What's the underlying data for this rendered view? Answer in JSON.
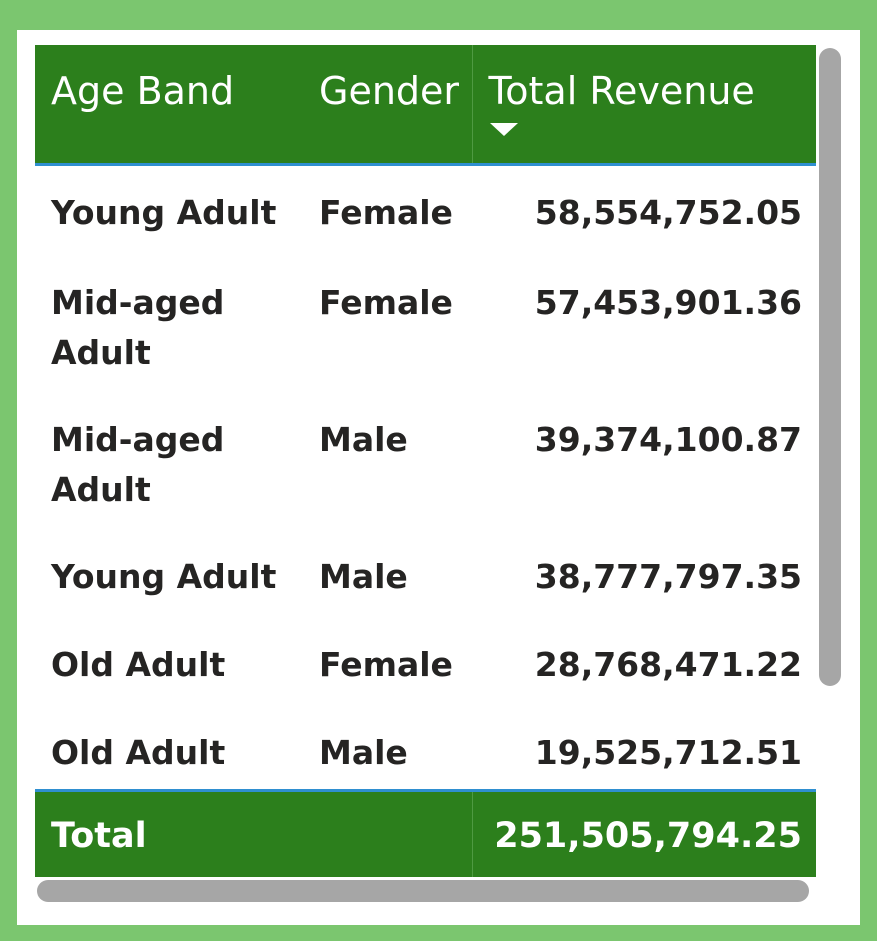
{
  "table": {
    "columns": [
      "Age Band",
      "Gender",
      "Total Revenue"
    ],
    "sort": {
      "column": "Total Revenue",
      "direction": "descending"
    },
    "rows": [
      {
        "age_band": "Young Adult",
        "gender": "Female",
        "total_revenue": "58,554,752.05"
      },
      {
        "age_band": "Mid-aged Adult",
        "gender": "Female",
        "total_revenue": "57,453,901.36"
      },
      {
        "age_band": "Mid-aged Adult",
        "gender": "Male",
        "total_revenue": "39,374,100.87"
      },
      {
        "age_band": "Young Adult",
        "gender": "Male",
        "total_revenue": "38,777,797.35"
      },
      {
        "age_band": "Old Adult",
        "gender": "Female",
        "total_revenue": "28,768,471.22"
      },
      {
        "age_band": "Old Adult",
        "gender": "Male",
        "total_revenue": "19,525,712.51"
      }
    ],
    "total": {
      "label": "Total",
      "value": "251,505,794.25"
    }
  },
  "icons": {
    "sort": "sort-descending-icon"
  },
  "colors": {
    "frame": "#7bc66f",
    "header": "#2c7f1c",
    "accent_rule": "#2f8fd0",
    "scrollbar": "#a6a6a6"
  }
}
